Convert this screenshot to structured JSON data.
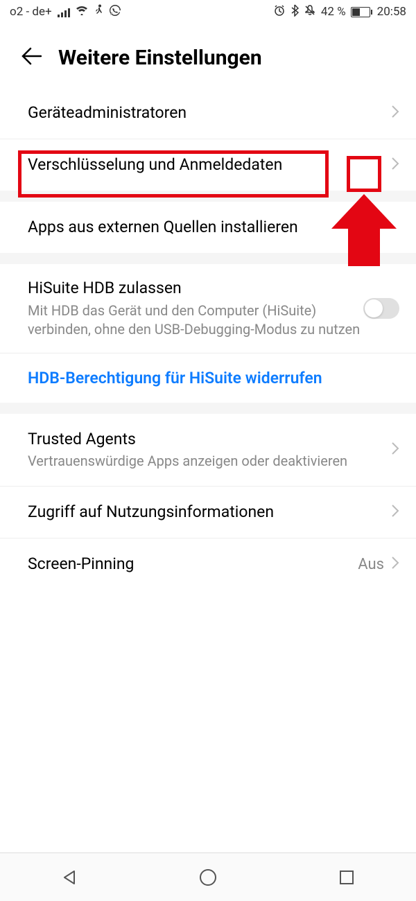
{
  "status_bar": {
    "carrier": "o2 - de+",
    "battery_percent": "42 %",
    "time": "20:58"
  },
  "header": {
    "title": "Weitere Einstellungen"
  },
  "rows": {
    "device_admins": {
      "label": "Geräteadministratoren"
    },
    "encryption": {
      "label": "Verschlüsselung und Anmeldedaten"
    },
    "external_apps": {
      "label": "Apps aus externen Quellen installieren"
    },
    "hisuite_hdb": {
      "label": "HiSuite HDB zulassen",
      "sublabel": "Mit HDB das Gerät und den Computer (HiSuite) verbinden, ohne den USB-Debugging-Modus zu nutzen"
    },
    "hdb_revoke": {
      "label": "HDB-Berechtigung für HiSuite widerrufen"
    },
    "trusted_agents": {
      "label": "Trusted Agents",
      "sublabel": "Vertrauenswürdige Apps anzeigen oder deaktivieren"
    },
    "usage_access": {
      "label": "Zugriff auf Nutzungsinformationen"
    },
    "screen_pinning": {
      "label": "Screen-Pinning",
      "value": "Aus"
    }
  }
}
